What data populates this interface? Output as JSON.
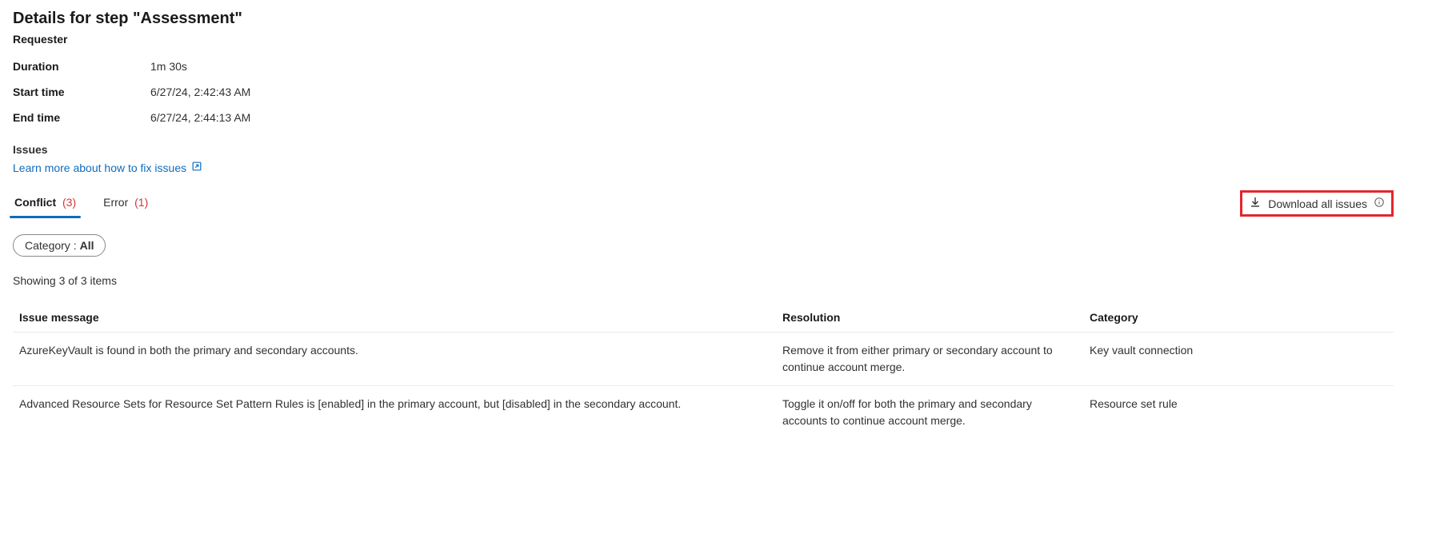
{
  "header": {
    "title": "Details for step \"Assessment\"",
    "requester_label": "Requester"
  },
  "meta": {
    "duration_label": "Duration",
    "duration_value": "1m 30s",
    "start_label": "Start time",
    "start_value": "6/27/24, 2:42:43 AM",
    "end_label": "End time",
    "end_value": "6/27/24, 2:44:13 AM"
  },
  "issues": {
    "heading": "Issues",
    "learn_link": "Learn more about how to fix issues"
  },
  "tabs": {
    "conflict_label": "Conflict",
    "conflict_count": "(3)",
    "error_label": "Error",
    "error_count": "(1)"
  },
  "download": {
    "label": "Download all issues"
  },
  "filter": {
    "key": "Category :",
    "value": "All"
  },
  "listing": {
    "showing": "Showing 3 of 3 items"
  },
  "table": {
    "headers": {
      "issue": "Issue message",
      "resolution": "Resolution",
      "category": "Category"
    },
    "rows": [
      {
        "issue": "AzureKeyVault is found in both the primary and secondary accounts.",
        "resolution": "Remove it from either primary or secondary account to continue account merge.",
        "category": "Key vault connection"
      },
      {
        "issue": "Advanced Resource Sets for Resource Set Pattern Rules is [enabled] in the primary account, but [disabled] in the secondary account.",
        "resolution": "Toggle it on/off for both the primary and secondary accounts to continue account merge.",
        "category": "Resource set rule"
      }
    ]
  }
}
